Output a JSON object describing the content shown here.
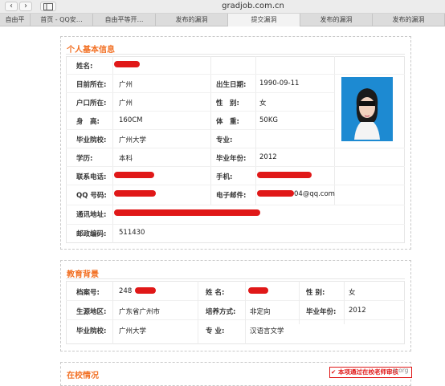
{
  "browser": {
    "url": "gradjob.com.cn",
    "tabs": [
      "自由平",
      "首页 - QQ安…",
      "自由平等开…",
      "发布的漏洞",
      "提交漏洞",
      "发布的漏洞",
      "发布的漏洞"
    ]
  },
  "personal": {
    "title": "个人基本信息",
    "name_label": "姓名:",
    "location_label": "目前所在:",
    "location": "广州",
    "birth_label": "出生日期:",
    "birth": "1990-09-11",
    "hukou_label": "户口所在:",
    "hukou": "广州",
    "gender_label": "性　别:",
    "gender": "女",
    "height_label": "身　高:",
    "height": "160CM",
    "weight_label": "体　重:",
    "weight": "50KG",
    "school_label": "毕业院校:",
    "school": "广州大学",
    "major_label": "专业:",
    "major": "",
    "degree_label": "学历:",
    "degree": "本科",
    "grad_year_label": "毕业年份:",
    "grad_year": "2012",
    "phone_label": "联系电话:",
    "mobile_label": "手机:",
    "qq_label": "QQ 号码:",
    "email_label": "电子邮件:",
    "email_suffix": "04@qq.com",
    "address_label": "通讯地址:",
    "zip_label": "邮政编码:",
    "zip": "511430"
  },
  "education": {
    "title": "教育背景",
    "file_label": "档案号:",
    "file_no": "248",
    "name_label": "姓 名:",
    "gender_label": "性 别:",
    "gender": "女",
    "origin_label": "生源地区:",
    "origin": "广东省广州市",
    "training_label": "培养方式:",
    "training": "非定向",
    "grad_year_label": "毕业年份:",
    "grad_year": "2012",
    "school_label": "毕业院校:",
    "school": "广州大学",
    "major_label": "专 业:",
    "major": "汉语言文学"
  },
  "campus": {
    "title": "在校情况"
  },
  "footer": {
    "stamp": "本项通过在校老师审核",
    "watermark": "n.org"
  }
}
